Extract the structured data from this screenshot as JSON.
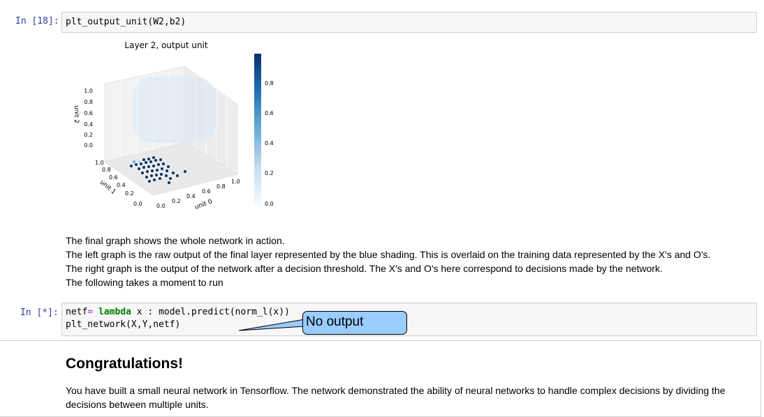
{
  "cell1": {
    "prompt": "In [18]:",
    "code_fn": "plt_output_unit",
    "code_args": "(W2,b2)"
  },
  "figure": {
    "title": "Layer 2, output unit",
    "zlabel": "unit 2",
    "ylabel": "unit 1",
    "xlabel": "unit 0",
    "z_ticks": [
      "1.0",
      "0.8",
      "0.6",
      "0.4",
      "0.2",
      "0.0"
    ],
    "y_ticks": [
      "1.0",
      "0.8",
      "0.6",
      "0.4",
      "0.2",
      "0.0"
    ],
    "x_ticks": [
      "0.0",
      "0.2",
      "0.4",
      "0.6",
      "0.8",
      "1.0"
    ],
    "colorbar_ticks": [
      "0.8",
      "0.6",
      "0.4",
      "0.2",
      "0.0"
    ],
    "colormap": "Blues",
    "accent_color": "#08306b"
  },
  "markdown": {
    "lines": [
      "The final graph shows the whole network in action.",
      "The left graph is the raw output of the final layer represented by the blue shading. This is overlaid on the training data represented by the X's and O's.",
      "The right graph is the output of the network after a decision threshold. The X's and O's here correspond to decisions made by the network.",
      "The following takes a moment to run"
    ]
  },
  "cell2": {
    "prompt": "In [*]:",
    "line1_a": "netf",
    "line1_eq": "=",
    "line1_kw": "lambda",
    "line1_b": " x : model.predict(norm_l(x))",
    "line2_fn": "plt_network",
    "line2_args": "(X,Y,netf)"
  },
  "callout": {
    "text": "No output",
    "color": "#99ccff"
  },
  "congrats": {
    "title": "Congratulations!",
    "body": "You have built a small neural network in Tensorflow. The network demonstrated the ability of neural networks to handle complex decisions by dividing the decisions between multiple units."
  }
}
